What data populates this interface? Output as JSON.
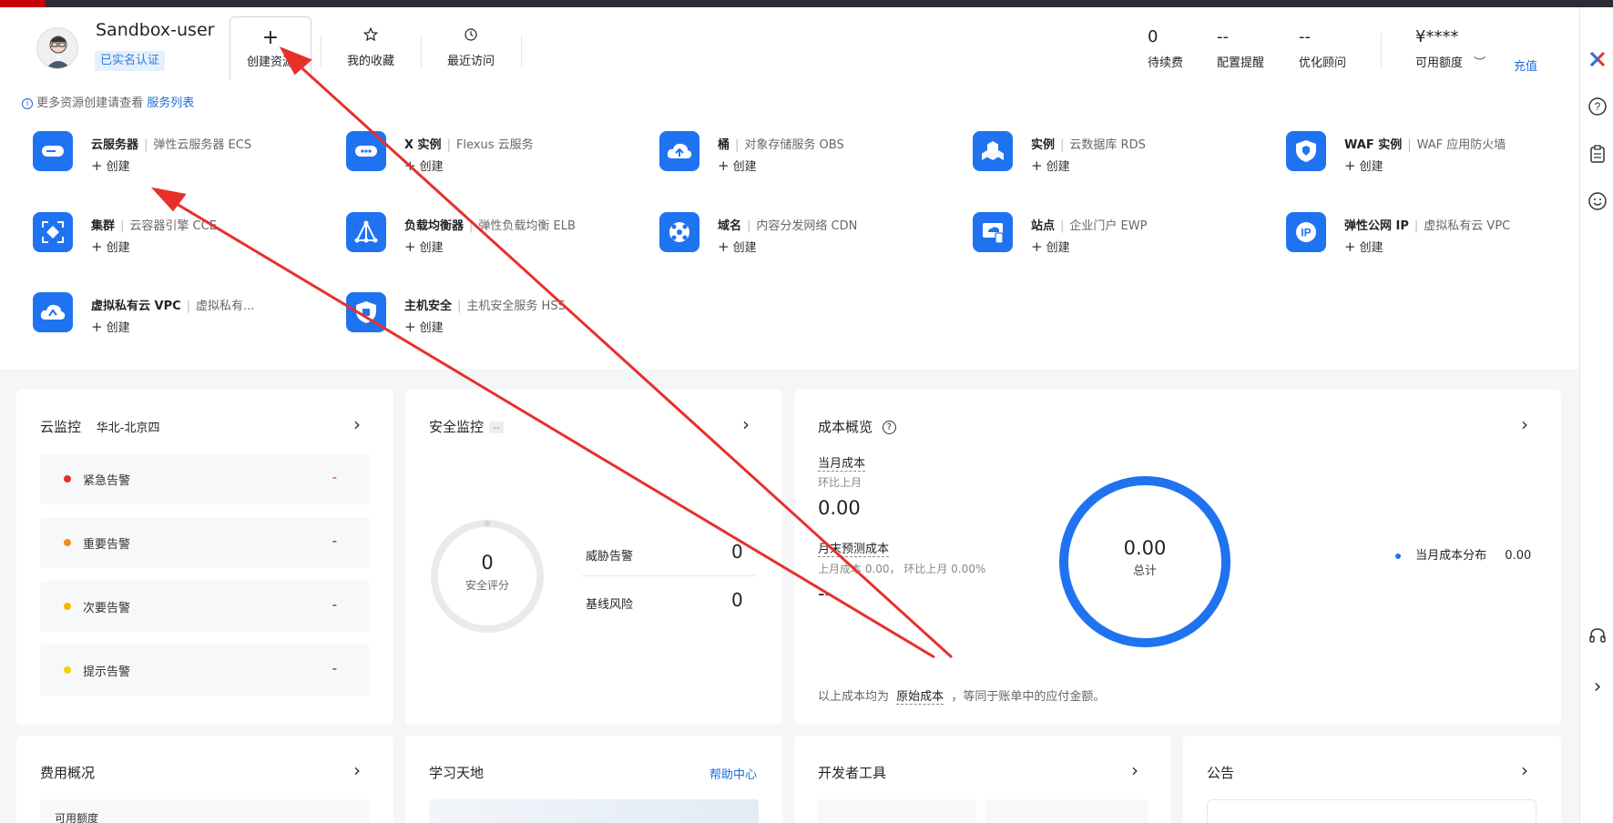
{
  "user": {
    "name": "Sandbox-user",
    "verified": "已实名认证"
  },
  "tabs": [
    {
      "icon": "plus-icon",
      "label": "创建资源"
    },
    {
      "icon": "star-icon",
      "label": "我的收藏"
    },
    {
      "icon": "clock-icon",
      "label": "最近访问"
    }
  ],
  "stats": {
    "pending": {
      "value": "0",
      "label": "待续费"
    },
    "config": {
      "value": "--",
      "label": "配置提醒"
    },
    "optimize": {
      "value": "--",
      "label": "优化顾问"
    },
    "balance": {
      "value": "¥****",
      "label": "可用额度",
      "recharge": "充值"
    }
  },
  "hint": {
    "text": "更多资源创建请查看",
    "link": "服务列表"
  },
  "services": [
    {
      "name": "云服务器",
      "sub": "弹性云服务器 ECS",
      "create": "创建",
      "icon": "server-icon"
    },
    {
      "name": "X 实例",
      "sub": "Flexus 云服务",
      "create": "创建",
      "icon": "flexus-icon"
    },
    {
      "name": "桶",
      "sub": "对象存储服务 OBS",
      "create": "创建",
      "icon": "cloud-upload-icon"
    },
    {
      "name": "实例",
      "sub": "云数据库 RDS",
      "create": "创建",
      "icon": "database-icon"
    },
    {
      "name": "WAF 实例",
      "sub": "WAF 应用防火墙",
      "create": "创建",
      "icon": "shield-icon"
    },
    {
      "name": "集群",
      "sub": "云容器引擎 CCE",
      "create": "创建",
      "icon": "cluster-icon"
    },
    {
      "name": "负载均衡器",
      "sub": "弹性负载均衡 ELB",
      "create": "创建",
      "icon": "load-balancer-icon"
    },
    {
      "name": "域名",
      "sub": "内容分发网络 CDN",
      "create": "创建",
      "icon": "cdn-icon"
    },
    {
      "name": "站点",
      "sub": "企业门户 EWP",
      "create": "创建",
      "icon": "site-icon"
    },
    {
      "name": "弹性公网 IP",
      "sub": "虚拟私有云 VPC",
      "create": "创建",
      "icon": "ip-icon"
    },
    {
      "name": "虚拟私有云 VPC",
      "sub": "虚拟私有...",
      "create": "创建",
      "icon": "vpc-icon"
    },
    {
      "name": "主机安全",
      "sub": "主机安全服务 HSS",
      "create": "创建",
      "icon": "host-security-icon"
    }
  ],
  "monitor": {
    "title": "云监控",
    "region": "华北-北京四",
    "alarms": [
      {
        "label": "紧急告警",
        "value": "-",
        "color": "#e52e2e"
      },
      {
        "label": "重要告警",
        "value": "-",
        "color": "#f08c1e"
      },
      {
        "label": "次要告警",
        "value": "-",
        "color": "#f5b800"
      },
      {
        "label": "提示告警",
        "value": "-",
        "color": "#f0d400"
      }
    ]
  },
  "security": {
    "title": "安全监控",
    "tag": "--",
    "score": "0",
    "score_label": "安全评分",
    "threat_label": "威胁告警",
    "threat_value": "0",
    "baseline_label": "基线风险",
    "baseline_value": "0"
  },
  "cost": {
    "title": "成本概览",
    "month_label": "当月成本",
    "mom_label": "环比上月",
    "month_value": "0.00",
    "forecast_label": "月末预测成本",
    "forecast_sub": "上月成本 0.00， 环比上月 0.00%",
    "forecast_value": "--",
    "total_value": "0.00",
    "total_label": "总计",
    "legend_label": "当月成本分布",
    "legend_value": "0.00",
    "footer_prefix": "以上成本均为",
    "footer_link": "原始成本",
    "footer_suffix": "，等同于账单中的应付金额。"
  },
  "bottom_cards": {
    "fees": {
      "title": "费用概况",
      "sub": "可用额度"
    },
    "learn": {
      "title": "学习天地",
      "link": "帮助中心"
    },
    "dev": {
      "title": "开发者工具"
    },
    "notice": {
      "title": "公告"
    }
  },
  "colors": {
    "accent": "#1f73f0",
    "annotation": "#e8302a"
  }
}
